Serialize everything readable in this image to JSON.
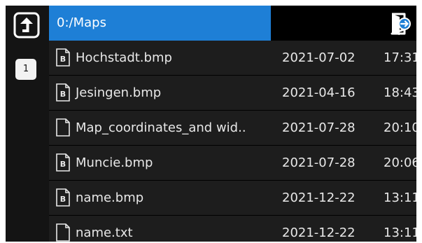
{
  "header": {
    "path": "0:/Maps"
  },
  "sidebar": {
    "page_number": "1"
  },
  "files": [
    {
      "name": "Hochstadt.bmp",
      "date": "2021-07-02",
      "time": "17:31",
      "icon": "bitmap-file-icon"
    },
    {
      "name": "Jesingen.bmp",
      "date": "2021-04-16",
      "time": "18:43",
      "icon": "bitmap-file-icon"
    },
    {
      "name": "Map_coordinates_and wid..",
      "date": "2021-07-28",
      "time": "20:10",
      "icon": "generic-file-icon"
    },
    {
      "name": "Muncie.bmp",
      "date": "2021-07-28",
      "time": "20:06",
      "icon": "bitmap-file-icon"
    },
    {
      "name": "name.bmp",
      "date": "2021-12-22",
      "time": "13:11",
      "icon": "bitmap-file-icon"
    },
    {
      "name": "name.txt",
      "date": "2021-12-22",
      "time": "13:11",
      "icon": "generic-file-icon"
    }
  ],
  "colors": {
    "path_bar": "#1e7fd6",
    "row_bg": "#1d1d1d",
    "sidebar_bg": "#141414"
  }
}
